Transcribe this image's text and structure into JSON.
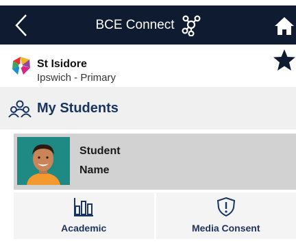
{
  "header": {
    "title": "BCE Connect"
  },
  "school": {
    "name": "St Isidore",
    "subtitle": "Ipswich - Primary"
  },
  "section": {
    "title": "My Students"
  },
  "student": {
    "name": "Student\nName"
  },
  "actions": [
    {
      "label": "Academic",
      "icon": "bar-chart-icon"
    },
    {
      "label": "Media Consent",
      "icon": "shield-alert-icon"
    }
  ],
  "colors": {
    "header_bg": "#0f1b31",
    "accent": "#173462",
    "star": "#0f1b31",
    "card_bg": "#d2d2d2",
    "avatar_bg": "#1f8a83"
  }
}
